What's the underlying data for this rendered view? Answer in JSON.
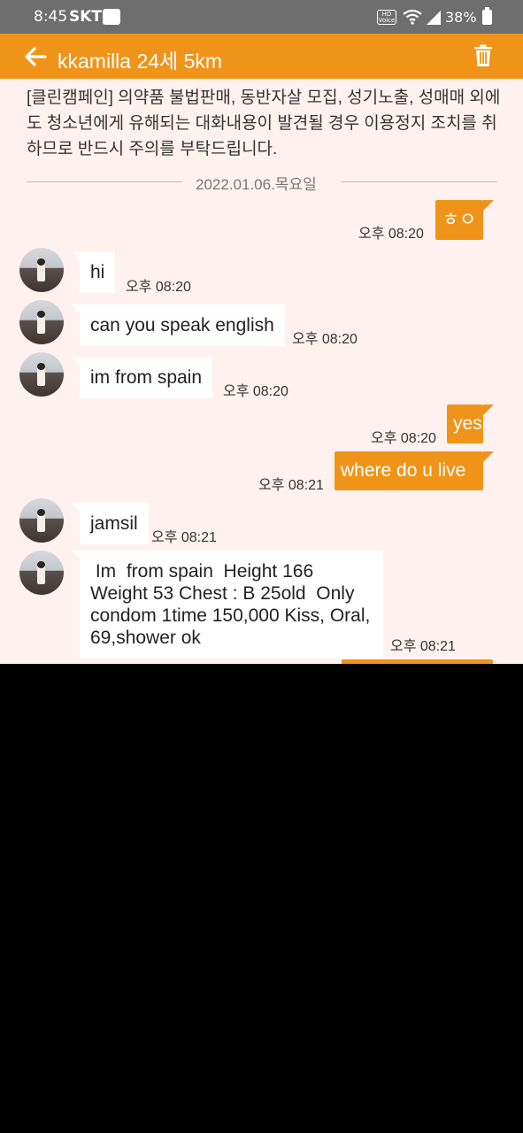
{
  "status_bar": {
    "time": "8:45",
    "carrier": "SKT",
    "carrier_badge": "LG",
    "hd_voice": "HD Voice",
    "battery": "38%"
  },
  "header": {
    "title": "kkamilla 24세 5km"
  },
  "notice": "[클린캠페인] 의약품 불법판매, 동반자살 모집, 성기노출, 성매매 외에도 청소년에게 유해되는 대화내용이 발견될 경우 이용정지 조치를 취하므로 반드시 주의를 부탁드립니다.",
  "date_separator": "2022.01.06.목요일",
  "messages": [
    {
      "side": "out",
      "text": "ㅎㅇ",
      "time": "오후 08:20"
    },
    {
      "side": "in",
      "text": "hi",
      "time": "오후 08:20"
    },
    {
      "side": "in",
      "text": "can you speak english",
      "time": "오후 08:20"
    },
    {
      "side": "in",
      "text": "im from spain",
      "time": "오후 08:20"
    },
    {
      "side": "out",
      "text": "yes",
      "time": "오후 08:20"
    },
    {
      "side": "out",
      "text": "where  do u  live",
      "time": "오후 08:21"
    },
    {
      "side": "in",
      "text": "jamsil",
      "time": "오후 08:21"
    },
    {
      "side": "in",
      "text": " Im  from spain  Height 166 Weight 53 Chest : B 25old  Only condom 1time 150,000 Kiss, Oral, 69,shower ok",
      "time": "오후 08:21"
    }
  ],
  "colors": {
    "accent": "#f09419",
    "chat_bg": "#fff1ef",
    "status_bar": "#6e6e6e"
  },
  "icons": [
    "back-arrow-icon",
    "trash-icon",
    "wifi-icon",
    "signal-icon",
    "battery-icon"
  ]
}
